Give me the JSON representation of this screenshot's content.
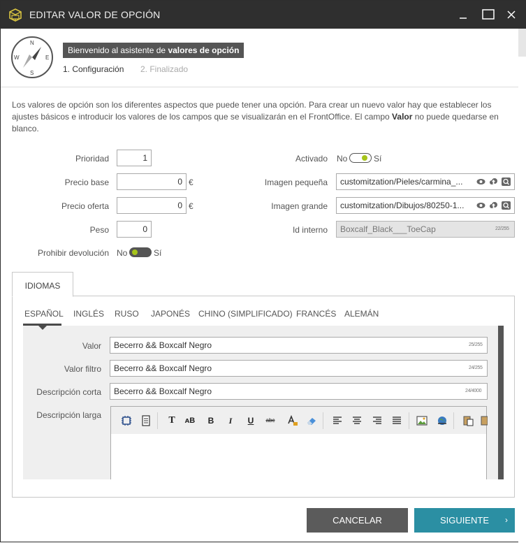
{
  "window": {
    "title": "EDITAR VALOR DE OPCIÓN",
    "icons": {
      "app": "cube-tag-icon",
      "minimize": "minimize-icon",
      "maximize": "maximize-icon",
      "close": "close-icon"
    },
    "colors": {
      "titlebar": "#2f2f2f",
      "accent": "#2b8fa3",
      "toggle_knob": "#a6c41a"
    }
  },
  "wizard": {
    "compass_letters": {
      "n": "N",
      "e": "E",
      "s": "S",
      "w": "W"
    },
    "welcome_prefix": "Bienvenido al asistente de ",
    "welcome_bold": "valores de opción",
    "step1": "1. Configuración",
    "step2": "2. Finalizado",
    "active_step": 1
  },
  "intro": {
    "part1": "Los valores de opción son los diferentes aspectos que puede tener una opción. Para crear un nuevo valor hay que establecer los ajustes básicos e introducir los valores de los campos que se visualizarán en el FrontOffice. El campo ",
    "bold": "Valor",
    "part2": " no puede quedarse en blanco."
  },
  "form": {
    "prioridad": {
      "label": "Prioridad",
      "value": "1"
    },
    "precio_base": {
      "label": "Precio base",
      "value": "0",
      "unit": "€"
    },
    "precio_oferta": {
      "label": "Precio oferta",
      "value": "0",
      "unit": "€"
    },
    "peso": {
      "label": "Peso",
      "value": "0"
    },
    "prohibir_devolucion": {
      "label": "Prohibir devolución",
      "off": "No",
      "on": "Sí",
      "enabled": false
    },
    "activado": {
      "label": "Activado",
      "off": "No",
      "on": "Sí",
      "enabled": true
    },
    "imagen_pequena": {
      "label": "Imagen pequeña",
      "value": "customitzation/Pieles/carmina_..."
    },
    "imagen_grande": {
      "label": "Imagen grande",
      "value": "customitzation/Dibujos/80250-1..."
    },
    "id_interno": {
      "label": "Id interno",
      "value": "Boxcalf_Black___ToeCap",
      "counter": "22/255"
    }
  },
  "tabs": {
    "main": "IDIOMAS",
    "languages": [
      "ESPAÑOL",
      "INGLÉS",
      "RUSO",
      "JAPONÉS",
      "CHINO (SIMPLIFICADO)",
      "FRANCÉS",
      "ALEMÁN"
    ],
    "active_language": 0
  },
  "lang_fields": {
    "valor": {
      "label": "Valor",
      "value": "Becerro && Boxcalf Negro",
      "counter": "25/255"
    },
    "valor_filtro": {
      "label": "Valor filtro",
      "value": "Becerro && Boxcalf Negro",
      "counter": "24/255"
    },
    "descripcion_corta": {
      "label": "Descripción corta",
      "value": "Becerro && Boxcalf Negro",
      "counter": "24/4000"
    },
    "descripcion_larga": {
      "label": "Descripción larga"
    }
  },
  "toolbar": {
    "bold_glyph": "B",
    "small_bold_glyph": "ᴀB",
    "italic_glyph": "I",
    "underline_glyph": "U",
    "strike_glyph": "abc",
    "text_glyph": "T",
    "icons": [
      "source-icon",
      "document-icon",
      "text-style-icon",
      "small-caps-icon",
      "bold-icon",
      "italic-icon",
      "underline-icon",
      "strikethrough-icon",
      "font-color-icon",
      "eraser-icon",
      "align-left-icon",
      "align-center-icon",
      "align-right-icon",
      "align-justify-icon",
      "image-icon",
      "link-globe-icon",
      "paste-icon",
      "paste-text-icon"
    ]
  },
  "buttons": {
    "cancel": "CANCELAR",
    "next": "SIGUIENTE",
    "next_chevron": "›"
  }
}
